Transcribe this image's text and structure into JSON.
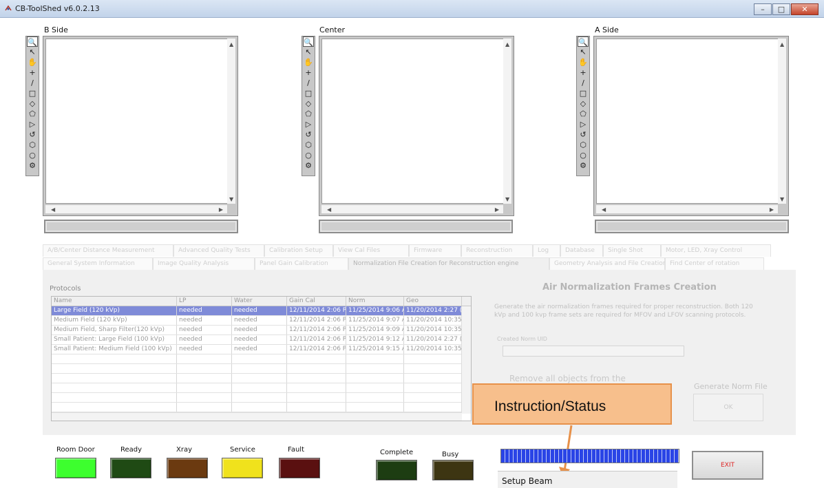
{
  "window": {
    "title": "CB-ToolShed v6.0.2.13",
    "minimize": "–",
    "maximize": "□",
    "close": "✕"
  },
  "panels": [
    {
      "label": "B Side"
    },
    {
      "label": "Center"
    },
    {
      "label": "A Side"
    }
  ],
  "tools": [
    "🔍",
    "↖",
    "✋",
    "+",
    "/",
    "□",
    "◇",
    "⬠",
    "▷",
    "↺",
    "⬡",
    "○",
    "⚙"
  ],
  "tabs": {
    "row1": [
      "A/B/Center Distance Measurement",
      "Advanced Quality Tests",
      "Calibration Setup",
      "View Cal Files",
      "Firmware",
      "Reconstruction",
      "Log",
      "Database",
      "Single Shot",
      "Motor, LED, Xray Control"
    ],
    "row2": [
      "General System Information",
      "Image Quality Analysis",
      "Panel Gain Calibration",
      "Normalization File Creation for Reconstruction engine",
      "Geometry Analysis and File Creation",
      "Find Center of rotation"
    ]
  },
  "protocols": {
    "label": "Protocols",
    "columns": [
      "Name",
      "LP",
      "Water",
      "Gain Cal",
      "Norm",
      "Geo"
    ],
    "rows": [
      [
        "Large Field (120 kVp)",
        "needed",
        "needed",
        "12/11/2014 2:06 P",
        "11/25/2014 9:06 A",
        "11/20/2014 2:27 ("
      ],
      [
        "Medium Field (120 kVp)",
        "needed",
        "needed",
        "12/11/2014 2:06 P",
        "11/25/2014 9:07 A",
        "11/20/2014 10:35"
      ],
      [
        "Medium Field, Sharp Filter(120 kVp)",
        "needed",
        "needed",
        "12/11/2014 2:06 P",
        "11/25/2014 9:09 A",
        "11/20/2014 10:35"
      ],
      [
        "Small Patient: Large Field (100 kVp)",
        "needed",
        "needed",
        "12/11/2014 2:06 P",
        "11/25/2014 9:12 A",
        "11/20/2014 2:27 ("
      ],
      [
        "Small Patient: Medium Field (100 kVp)",
        "needed",
        "needed",
        "12/11/2014 2:06 P",
        "11/25/2014 9:15 A",
        "11/20/2014 10:35"
      ]
    ],
    "empty_rows": 6
  },
  "air_norm": {
    "title": "Air Normalization Frames Creation",
    "description": "Generate the air normalization frames required for proper reconstruction. Both 120 kVp and 100 kvp frame sets are required for MFOV and LFOV scanning protocols.",
    "uid_label": "Created Norm UID",
    "remove_text": "Remove all objects from the",
    "generate_label": "Generate Norm File",
    "ok_label": "OK"
  },
  "callout": {
    "text": "Instruction/Status"
  },
  "indicators": [
    {
      "label": "Room Door",
      "color": "#3dff2e"
    },
    {
      "label": "Ready",
      "color": "#1f4a14"
    },
    {
      "label": "Xray",
      "color": "#6b3a10"
    },
    {
      "label": "Service",
      "color": "#f0e21c"
    },
    {
      "label": "Fault",
      "color": "#5a1010"
    },
    {
      "label": "Complete",
      "color": "#1d3d12"
    },
    {
      "label": "Busy",
      "color": "#3d3512"
    }
  ],
  "status": {
    "text": "Setup Beam",
    "progress": 1.0
  },
  "exit_label": "EXIT"
}
